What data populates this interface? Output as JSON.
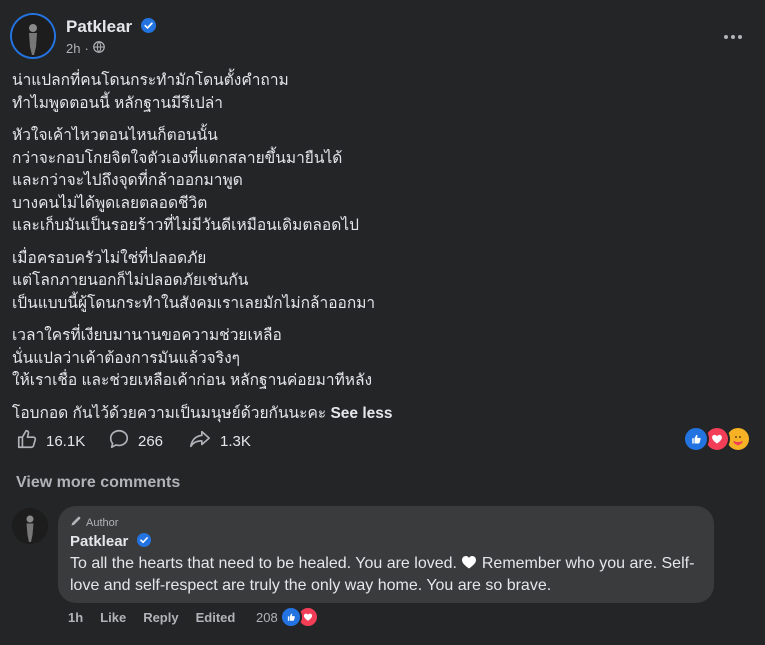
{
  "header": {
    "author": "Patklear",
    "time": "2h",
    "dot": "·"
  },
  "post": {
    "paragraphs": [
      [
        "น่าแปลกที่คนโดนกระทำมักโดนตั้งคำถาม",
        "ทำไมพูดตอนนี้ หลักฐานมีรึเปล่า"
      ],
      [
        "หัวใจเค้าไหวตอนไหนก็ตอนนั้น",
        "กว่าจะกอบโกยจิตใจตัวเองที่แตกสลายขึ้นมายืนได้",
        "และกว่าจะไปถึงจุดที่กล้าออกมาพูด",
        "บางคนไม่ได้พูดเลยตลอดชีวิต",
        "และเก็บมันเป็นรอยร้าวที่ไม่มีวันดีเหมือนเดิมตลอดไป"
      ],
      [
        "เมื่อครอบครัวไม่ใช่ที่ปลอดภัย",
        "แต่โลกภายนอกก็ไม่ปลอดภัยเช่นกัน",
        "เป็นแบบนี้ผู้โดนกระทำในสังคมเราเลยมักไม่กล้าออกมา"
      ],
      [
        "เวลาใครที่เงียบมานานขอความช่วยเหลือ",
        "นั่นแปลว่าเค้าต้องการมันแล้วจริงๆ",
        "ให้เราเชื่อ และช่วยเหลือเค้าก่อน หลักฐานค่อยมาทีหลัง"
      ]
    ],
    "last_line": "โอบกอด กันไว้ด้วยความเป็นมนุษย์ด้วยกันนะคะ",
    "see_less": "See less"
  },
  "stats": {
    "likes": "16.1K",
    "comments": "266",
    "shares": "1.3K"
  },
  "view_more_comments": "View more comments",
  "comment": {
    "badge": "Author",
    "author": "Patklear",
    "text_before": "To all the hearts that need to be healed. You are loved.",
    "text_after": "Remember who you are. Self-love and self-respect are truly the only way home. You are so brave.",
    "time": "1h",
    "like": "Like",
    "reply": "Reply",
    "edited": "Edited",
    "reaction_count": "208"
  },
  "colors": {
    "background": "#242526",
    "bubble": "#3a3b3c",
    "text": "#e4e6eb",
    "secondary": "#b0b3b8",
    "accent": "#2374e1",
    "heart": "#f33e58",
    "care": "#f7b125"
  },
  "icons": [
    "verified-icon",
    "globe-icon",
    "more-icon",
    "like-icon",
    "comment-icon",
    "share-icon",
    "pencil-icon",
    "white-heart-icon"
  ]
}
